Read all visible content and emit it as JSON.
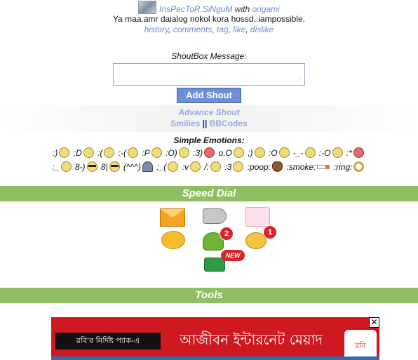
{
  "post": {
    "author": "InsPecToR SiNguM",
    "with_label": "with",
    "with_user": "origami",
    "message": "Ya maa.amr daialog nokol kora hossd..iampossible.",
    "actions": [
      "history",
      "comments",
      "tag",
      "like",
      "dislike"
    ]
  },
  "shoutbox": {
    "label": "ShoutBox Message:",
    "textarea_value": "",
    "button": "Add Shout"
  },
  "links": {
    "advance": "Advance Shout",
    "smilies": "Smilies",
    "separator": "||",
    "bbcodes": "BBCodes"
  },
  "emotions": {
    "title": "Simple Emotions:",
    "row1": [
      ":)",
      ":D",
      ":(",
      ":-(",
      ":P",
      ":O)",
      ":3)",
      "o.O",
      ";)",
      ":O",
      "-_-",
      ":-O",
      ":*"
    ],
    "row2": [
      ":_",
      "8-)",
      "8|",
      "(^^^)",
      ":_(",
      ":v",
      "/:",
      ":3",
      ":poop:",
      ":smoke:",
      ":ring:"
    ]
  },
  "speed_dial": {
    "title": "Speed Dial",
    "icons": [
      "envelope-icon",
      "megaphone-icon",
      "sms-icon",
      "chat-bubble-icon",
      "people-icon",
      "coins-icon",
      "money-icon"
    ],
    "badges": {
      "people": "2",
      "coins": "1",
      "money": "NEW"
    }
  },
  "tools": {
    "title": "Tools"
  },
  "ad": {
    "left_text": "রবি'র নির্দিষ্ট প্যাক-এ",
    "main_text": "আজীবন ইন্টারনেট মেয়াদ",
    "logo": "রবি",
    "close": "✕"
  },
  "colors": {
    "bar": "#8fbe63",
    "link": "#6b8fc9",
    "button": "#6e8fd8",
    "ad": "#cf1820"
  }
}
